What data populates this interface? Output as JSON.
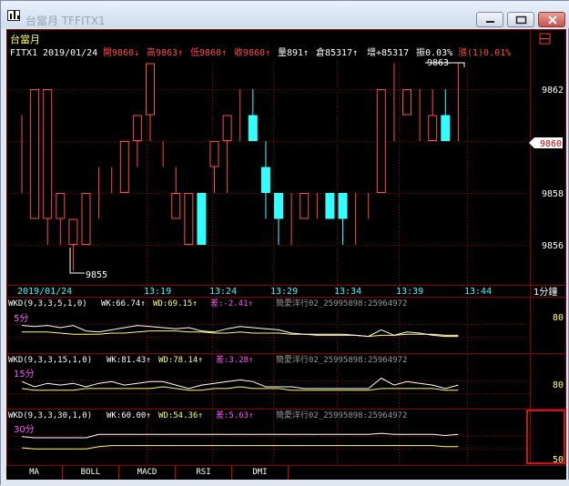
{
  "window": {
    "title": "台當月 TFFITX1",
    "buttons": [
      "minimize",
      "maximize",
      "close"
    ]
  },
  "quote": {
    "name": "台當月",
    "symbol": "FITX1",
    "date": "2019/01/24",
    "open": "開9860↓",
    "high": "高9863↑",
    "low": "低9860↑",
    "close": "收9860↑",
    "volume": "量891↑",
    "oi": "倉85317↑",
    "oi_change": "增+85317",
    "amplitude": "振0.03%",
    "change": "漲(1)0.01%"
  },
  "main_chart": {
    "y_ticks": [
      "9862",
      "9860",
      "9858",
      "9856"
    ],
    "current_price": "9860",
    "x_date": "2019/01/24",
    "x_ticks": [
      "13:19",
      "13:24",
      "13:29",
      "13:34",
      "13:39",
      "13:44"
    ],
    "period": "1分鐘",
    "high_label": "9863",
    "low_label": "9855",
    "candles": [
      [
        9860,
        9860,
        9858,
        9861
      ],
      [
        9857,
        9862,
        9857,
        9862
      ],
      [
        9857,
        9862,
        9856,
        9862
      ],
      [
        9857,
        9858,
        9856,
        9858
      ],
      [
        9856,
        9857,
        9855,
        9857
      ],
      [
        9856,
        9858,
        9856,
        9858
      ],
      [
        9858,
        9858,
        9857,
        9859
      ],
      [
        9858,
        9858,
        9858,
        9859
      ],
      [
        9858,
        9860,
        9858,
        9860
      ],
      [
        9860,
        9861,
        9859,
        9861
      ],
      [
        9861,
        9863,
        9860,
        9863
      ],
      [
        9860,
        9860,
        9859,
        9860
      ],
      [
        9857,
        9858,
        9857,
        9859
      ],
      [
        9856,
        9858,
        9856,
        9858
      ],
      [
        9858,
        9856,
        9856,
        9858
      ],
      [
        9859,
        9860,
        9858,
        9860
      ],
      [
        9860,
        9861,
        9858,
        9861
      ],
      [
        9861,
        9861,
        9860,
        9862
      ],
      [
        9861,
        9860,
        9860,
        9862
      ],
      [
        9859,
        9858,
        9857,
        9860
      ],
      [
        9858,
        9857,
        9856,
        9858
      ],
      [
        9857,
        9857,
        9856,
        9858
      ],
      [
        9857,
        9858,
        9857,
        9858
      ],
      [
        9858,
        9858,
        9857,
        9858
      ],
      [
        9858,
        9857,
        9857,
        9858
      ],
      [
        9858,
        9857,
        9856,
        9858
      ],
      [
        9857,
        9857,
        9856,
        9858
      ],
      [
        9857,
        9857,
        9857,
        9858
      ],
      [
        9858,
        9862,
        9858,
        9862
      ],
      [
        9862,
        9862,
        9860,
        9863
      ],
      [
        9861,
        9862,
        9861,
        9862
      ],
      [
        9861,
        9861,
        9860,
        9862
      ],
      [
        9860,
        9861,
        9860,
        9862
      ],
      [
        9861,
        9860,
        9860,
        9862
      ],
      [
        9860,
        9860,
        9860,
        9863
      ]
    ]
  },
  "indicators": [
    {
      "params": "WKD(9,3,3,5,1,0)",
      "wk": "WK:66.74↑",
      "wd": "WD:69.15↑",
      "diff": "差:-2.41↑",
      "info": "簡愛洋行02_25995898:25964972",
      "period": "5分",
      "tick": "80",
      "wk_values": [
        82,
        81,
        82,
        80,
        82,
        77,
        76,
        78,
        80,
        82,
        81,
        80,
        79,
        80,
        77,
        76,
        79,
        81,
        80,
        79,
        78,
        75,
        74,
        74,
        74,
        74,
        73,
        72,
        78,
        73,
        76,
        75,
        73,
        72,
        72
      ],
      "wd_values": [
        76,
        76,
        76,
        75,
        74,
        74,
        74,
        75,
        75,
        76,
        77,
        77,
        77,
        76,
        76,
        75,
        75,
        76,
        75,
        75,
        75,
        74,
        74,
        73,
        73,
        73,
        73,
        72,
        73,
        73,
        74,
        74,
        74,
        73,
        73
      ]
    },
    {
      "params": "WKD(9,3,3,15,1,0)",
      "wk": "WK:81.43↑",
      "wd": "WD:78.14↑",
      "diff": "差:3.28↑",
      "info": "簡愛洋行02_25995898:25964972",
      "period": "15分",
      "tick": "80",
      "wk_values": [
        84,
        81,
        83,
        82,
        83,
        81,
        83,
        84,
        82,
        83,
        84,
        84,
        82,
        80,
        82,
        83,
        84,
        85,
        84,
        81,
        81,
        81,
        80,
        80,
        80,
        80,
        80,
        80,
        86,
        82,
        84,
        83,
        82,
        80,
        82
      ],
      "wd_values": [
        80,
        79,
        79,
        79,
        79,
        80,
        80,
        80,
        80,
        80,
        80,
        81,
        80,
        79,
        79,
        80,
        80,
        81,
        80,
        80,
        80,
        79,
        79,
        79,
        79,
        79,
        79,
        79,
        80,
        80,
        80,
        80,
        80,
        79,
        79
      ]
    },
    {
      "params": "WKD(9,3,3,30,1,0)",
      "wk": "WK:60.00↑",
      "wd": "WD:54.36↑",
      "diff": "差:5.63↑",
      "info": "簡愛洋行02_25995898:25964972",
      "period": "30分",
      "tick": "50",
      "wk_values": [
        63,
        62,
        62,
        62,
        62,
        62,
        65,
        65,
        65,
        65,
        65,
        65,
        65,
        65,
        65,
        65,
        65,
        65,
        65,
        65,
        65,
        65,
        65,
        65,
        65,
        65,
        65,
        65,
        66,
        65,
        65,
        65,
        65,
        64,
        65
      ],
      "wd_values": [
        53,
        52,
        52,
        52,
        52,
        52,
        54,
        55,
        55,
        55,
        55,
        55,
        55,
        55,
        55,
        55,
        55,
        55,
        55,
        55,
        55,
        55,
        55,
        55,
        55,
        55,
        55,
        55,
        55,
        55,
        55,
        55,
        55,
        54,
        54
      ]
    }
  ],
  "tabs": [
    "MA",
    "BOLL",
    "MACD",
    "RSI",
    "DMI"
  ],
  "colors": {
    "up": "#ff4a4a",
    "down": "#33ffff",
    "grid": "#8a0000",
    "wk_line": "#ffffff",
    "wd_line": "#ffff66",
    "label_purple": "#ff55ff"
  }
}
